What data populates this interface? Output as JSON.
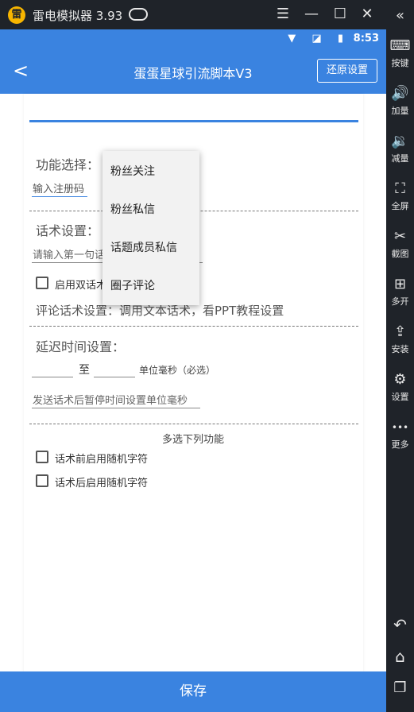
{
  "emulator": {
    "title": "雷电模拟器 3.93",
    "logo": "雷",
    "toolbar": [
      {
        "icon": "keyboard-icon",
        "glyph": "⌨",
        "label": "按键"
      },
      {
        "icon": "volume-up-icon",
        "glyph": "🔊",
        "label": "加量"
      },
      {
        "icon": "volume-down-icon",
        "glyph": "🔉",
        "label": "减量"
      },
      {
        "icon": "fullscreen-icon",
        "glyph": "⛶",
        "label": "全屏"
      },
      {
        "icon": "scissors-icon",
        "glyph": "✂",
        "label": "截图"
      },
      {
        "icon": "multi-open-icon",
        "glyph": "⊞",
        "label": "多开"
      },
      {
        "icon": "apk-install-icon",
        "glyph": "⇪",
        "label": "安装"
      },
      {
        "icon": "gear-icon",
        "glyph": "⚙",
        "label": "设置"
      },
      {
        "icon": "more-icon",
        "glyph": "•••",
        "label": "更多"
      }
    ],
    "nav": {
      "back": "↶",
      "home": "⌂",
      "recents": "❐"
    }
  },
  "status_bar": {
    "icons": "▼ ◪ ▮",
    "time": "8:53"
  },
  "app_bar": {
    "back": "<",
    "title": "蛋蛋星球引流脚本V3",
    "restore_label": "还原设置"
  },
  "form": {
    "function_label": "功能选择：",
    "reg_code_placeholder": "输入注册码",
    "script_label": "话术设置：",
    "first_line_placeholder": "请输入第一句话术",
    "enable_double": "启用双话术",
    "comment_note": "评论话术设置：调用文本话术，看PPT教程设置",
    "delay_label": "延迟时间设置：",
    "to": "至",
    "unit_note": "单位毫秒（必选）",
    "pause_placeholder": "发送话术后暂停时间设置单位毫秒",
    "multi_title": "多选下列功能",
    "checkbox1": "话术前启用随机字符",
    "checkbox2": "话术后启用随机字符"
  },
  "dropdown": {
    "options": [
      "粉丝关注",
      "粉丝私信",
      "话题成员私信",
      "圈子评论"
    ]
  },
  "save_label": "保存"
}
